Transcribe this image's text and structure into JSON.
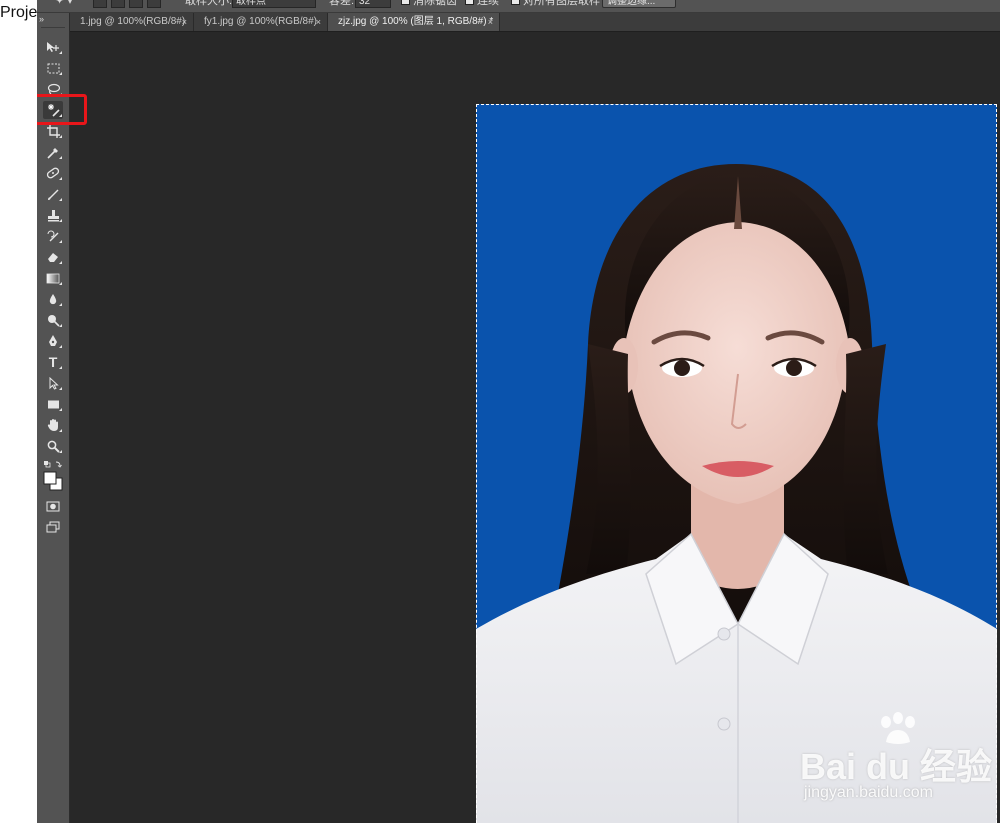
{
  "outside": {
    "project_label": "Proje"
  },
  "options_bar": {
    "sample_size_label": "取样大小:",
    "sample_size_value": "取样点",
    "tolerance_label": "容差:",
    "tolerance_value": "32",
    "antialias_label": "消除锯齿",
    "contiguous_label": "连续",
    "sample_all_layers_label": "对所有图层取样",
    "refine_edge_label": "调整边缘..."
  },
  "toolbox": {
    "collapse_glyph": "»",
    "tools": [
      {
        "name": "move-tool",
        "icon": "move-icon"
      },
      {
        "name": "rectangular-marquee-tool",
        "icon": "marquee-icon"
      },
      {
        "name": "lasso-tool",
        "icon": "lasso-icon"
      },
      {
        "name": "magic-wand-tool",
        "icon": "magic-wand-icon",
        "selected": true
      },
      {
        "name": "crop-tool",
        "icon": "crop-icon"
      },
      {
        "name": "eyedropper-tool",
        "icon": "eyedropper-icon"
      },
      {
        "name": "spot-healing-tool",
        "icon": "bandage-icon"
      },
      {
        "name": "brush-tool",
        "icon": "brush-icon"
      },
      {
        "name": "clone-stamp-tool",
        "icon": "stamp-icon"
      },
      {
        "name": "history-brush-tool",
        "icon": "history-brush-icon"
      },
      {
        "name": "eraser-tool",
        "icon": "eraser-icon"
      },
      {
        "name": "gradient-tool",
        "icon": "gradient-icon"
      },
      {
        "name": "blur-tool",
        "icon": "drop-icon"
      },
      {
        "name": "dodge-tool",
        "icon": "dodge-icon"
      },
      {
        "name": "pen-tool",
        "icon": "pen-icon"
      },
      {
        "name": "type-tool",
        "icon": "type-icon",
        "glyph": "T"
      },
      {
        "name": "path-selection-tool",
        "icon": "arrow-icon"
      },
      {
        "name": "rectangle-tool",
        "icon": "rectangle-icon"
      },
      {
        "name": "hand-tool",
        "icon": "hand-icon"
      },
      {
        "name": "zoom-tool",
        "icon": "magnifier-icon"
      }
    ],
    "foreground_color": "#ffffff",
    "background_color": "#ffffff"
  },
  "tabs": [
    {
      "title": "1.jpg @ 100%(RGB/8#)",
      "close": "×",
      "active": false
    },
    {
      "title": "fy1.jpg @ 100%(RGB/8#)",
      "close": "×",
      "active": false
    },
    {
      "title": "zjz.jpg @ 100% (图层 1, RGB/8#) *",
      "close": "×",
      "active": true
    }
  ],
  "document": {
    "background_color": "#0a53ad"
  },
  "watermark": {
    "brand": "Bai du 经验",
    "site": "jingyan.baidu.com"
  },
  "highlight_color": "#e8161a"
}
